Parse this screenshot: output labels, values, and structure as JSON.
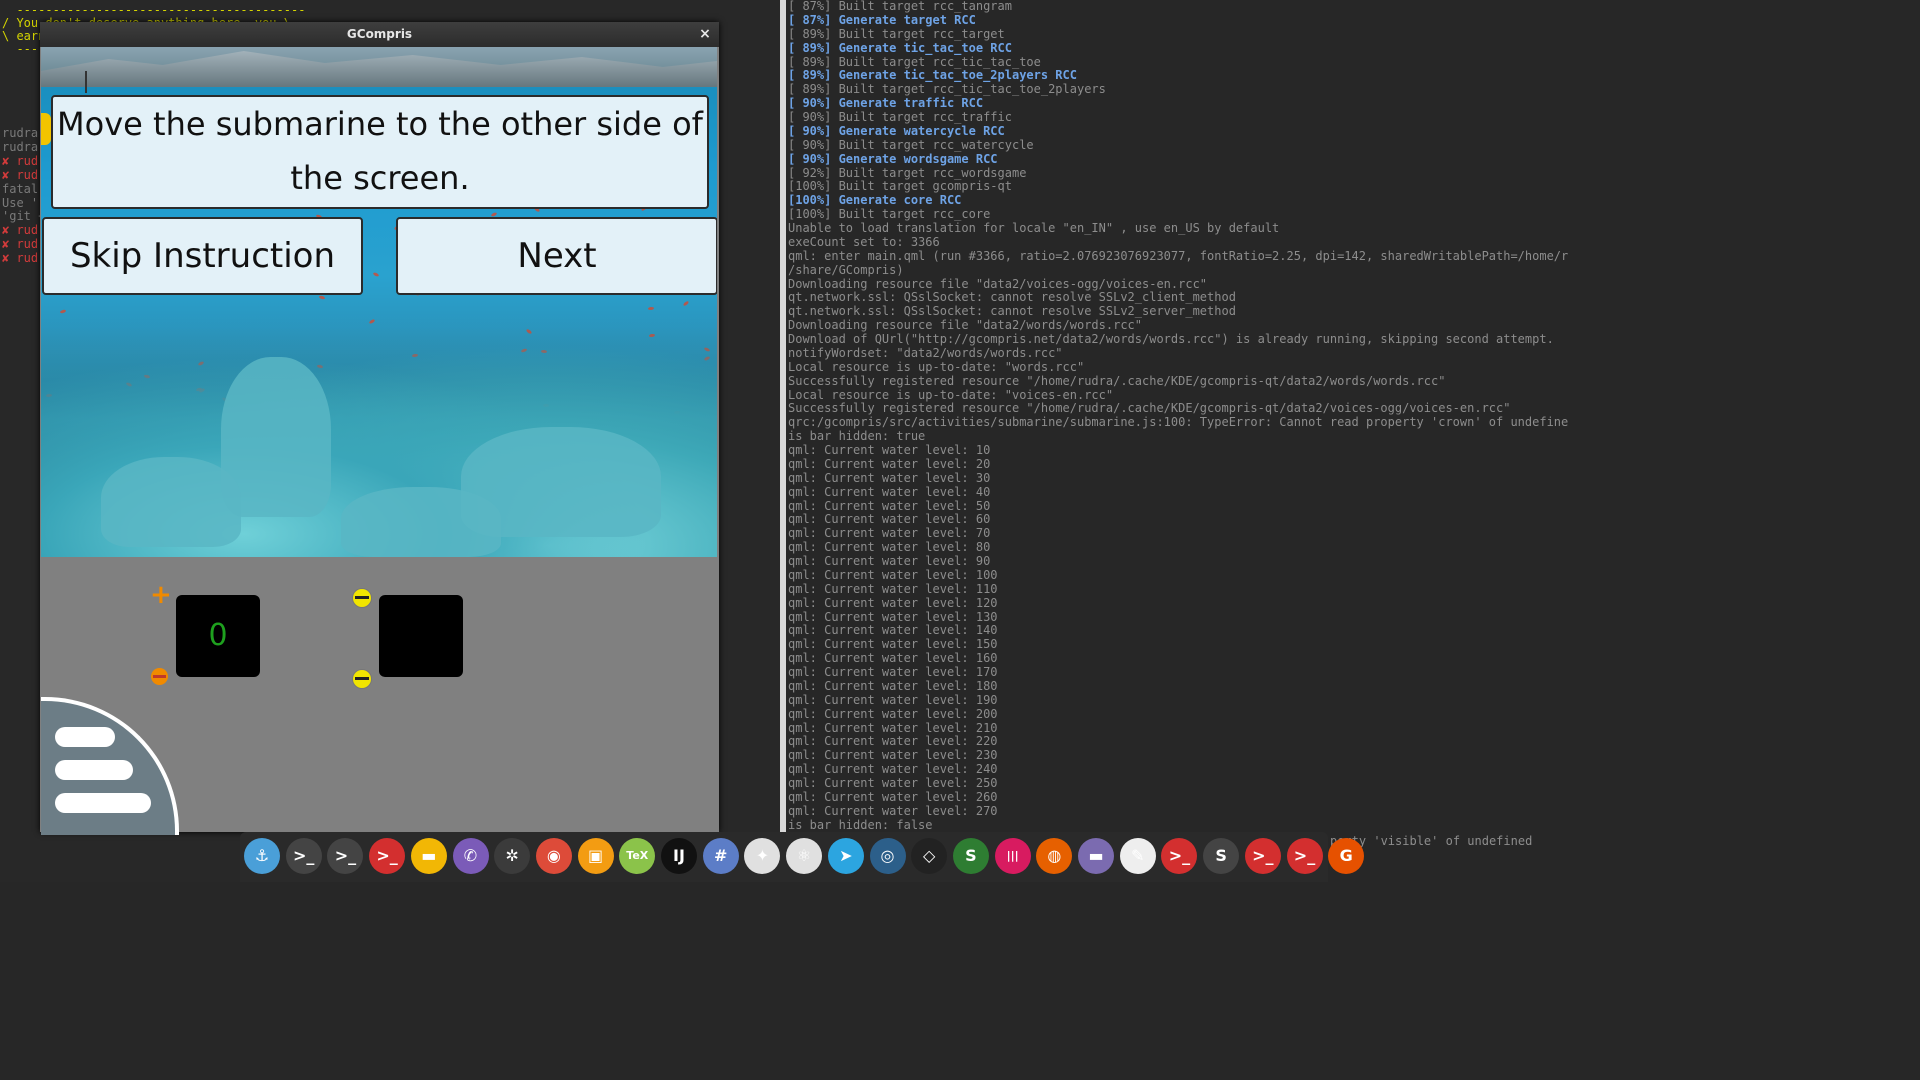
{
  "left_terminal": {
    "cowsay": [
      "  ----------------------------------------",
      "/ You don't deserve anything here, you \\",
      "\\ earn",
      "  ----"
    ],
    "snippets": [
      {
        "text": "rudra",
        "red": false
      },
      {
        "text": "rudra",
        "red": false
      },
      {
        "text": "✘ rud",
        "red": true
      },
      {
        "text": "✘ rud",
        "red": true
      },
      {
        "text": "fatal:",
        "red": false
      },
      {
        "text": "Use '-",
        "red": false
      },
      {
        "text": "'git <",
        "red": false
      },
      {
        "text": "✘ rud",
        "red": true
      },
      {
        "text": "✘ rud",
        "red": true
      },
      {
        "text": "✘ rud",
        "red": true
      }
    ]
  },
  "right_terminal": {
    "lines": [
      {
        "text": "[ 87%] Built target rcc_tangram",
        "gen": false
      },
      {
        "text": "[ 87%] Generate target RCC",
        "gen": true
      },
      {
        "text": "[ 89%] Built target rcc_target",
        "gen": false
      },
      {
        "text": "[ 89%] Generate tic_tac_toe RCC",
        "gen": true
      },
      {
        "text": "[ 89%] Built target rcc_tic_tac_toe",
        "gen": false
      },
      {
        "text": "[ 89%] Generate tic_tac_toe_2players RCC",
        "gen": true
      },
      {
        "text": "[ 89%] Built target rcc_tic_tac_toe_2players",
        "gen": false
      },
      {
        "text": "[ 90%] Generate traffic RCC",
        "gen": true
      },
      {
        "text": "[ 90%] Built target rcc_traffic",
        "gen": false
      },
      {
        "text": "[ 90%] Generate watercycle RCC",
        "gen": true
      },
      {
        "text": "[ 90%] Built target rcc_watercycle",
        "gen": false
      },
      {
        "text": "[ 90%] Generate wordsgame RCC",
        "gen": true
      },
      {
        "text": "[ 92%] Built target rcc_wordsgame",
        "gen": false
      },
      {
        "text": "[100%] Built target gcompris-qt",
        "gen": false
      },
      {
        "text": "[100%] Generate core RCC",
        "gen": true
      },
      {
        "text": "[100%] Built target rcc_core",
        "gen": false
      },
      {
        "text": "Unable to load translation for locale  \"en_IN\" , use en_US by default",
        "gen": false
      },
      {
        "text": "exeCount set to:  3366",
        "gen": false
      },
      {
        "text": "qml: enter main.qml (run #3366, ratio=2.076923076923077, fontRatio=2.25, dpi=142, sharedWritablePath=/home/rudra/.local",
        "gen": false
      },
      {
        "text": "/share/GCompris)",
        "gen": false
      },
      {
        "text": "Downloading resource file \"data2/voices-ogg/voices-en.rcc\"",
        "gen": false
      },
      {
        "text": "qt.network.ssl: QSslSocket: cannot resolve SSLv2_client_method",
        "gen": false
      },
      {
        "text": "qt.network.ssl: QSslSocket: cannot resolve SSLv2_server_method",
        "gen": false
      },
      {
        "text": "Downloading resource file \"data2/words/words.rcc\"",
        "gen": false
      },
      {
        "text": "Download of QUrl(\"http://gcompris.net/data2/words/words.rcc\") is already running, skipping second attempt.",
        "gen": false
      },
      {
        "text": "notifyWordset:  \"data2/words/words.rcc\"",
        "gen": false
      },
      {
        "text": "Local resource is up-to-date: \"words.rcc\"",
        "gen": false
      },
      {
        "text": "Successfully registered resource \"/home/rudra/.cache/KDE/gcompris-qt/data2/words/words.rcc\"",
        "gen": false
      },
      {
        "text": "Local resource is up-to-date: \"voices-en.rcc\"",
        "gen": false
      },
      {
        "text": "Successfully registered resource \"/home/rudra/.cache/KDE/gcompris-qt/data2/voices-ogg/voices-en.rcc\"",
        "gen": false
      },
      {
        "text": "qrc:/gcompris/src/activities/submarine/submarine.js:100: TypeError: Cannot read property 'crown' of undefined",
        "gen": false
      },
      {
        "text": "is bar hidden:  true",
        "gen": false
      },
      {
        "text": "qml: Current water level: 10",
        "gen": false
      },
      {
        "text": "qml: Current water level: 20",
        "gen": false
      },
      {
        "text": "qml: Current water level: 30",
        "gen": false
      },
      {
        "text": "qml: Current water level: 40",
        "gen": false
      },
      {
        "text": "qml: Current water level: 50",
        "gen": false
      },
      {
        "text": "qml: Current water level: 60",
        "gen": false
      },
      {
        "text": "qml: Current water level: 70",
        "gen": false
      },
      {
        "text": "qml: Current water level: 80",
        "gen": false
      },
      {
        "text": "qml: Current water level: 90",
        "gen": false
      },
      {
        "text": "qml: Current water level: 100",
        "gen": false
      },
      {
        "text": "qml: Current water level: 110",
        "gen": false
      },
      {
        "text": "qml: Current water level: 120",
        "gen": false
      },
      {
        "text": "qml: Current water level: 130",
        "gen": false
      },
      {
        "text": "qml: Current water level: 140",
        "gen": false
      },
      {
        "text": "qml: Current water level: 150",
        "gen": false
      },
      {
        "text": "qml: Current water level: 160",
        "gen": false
      },
      {
        "text": "qml: Current water level: 170",
        "gen": false
      },
      {
        "text": "qml: Current water level: 180",
        "gen": false
      },
      {
        "text": "qml: Current water level: 190",
        "gen": false
      },
      {
        "text": "qml: Current water level: 200",
        "gen": false
      },
      {
        "text": "qml: Current water level: 210",
        "gen": false
      },
      {
        "text": "qml: Current water level: 220",
        "gen": false
      },
      {
        "text": "qml: Current water level: 230",
        "gen": false
      },
      {
        "text": "qml: Current water level: 240",
        "gen": false
      },
      {
        "text": "qml: Current water level: 250",
        "gen": false
      },
      {
        "text": "qml: Current water level: 260",
        "gen": false
      },
      {
        "text": "qml: Current water level: 270",
        "gen": false
      },
      {
        "text": "is bar hidden:  false",
        "gen": false
      }
    ],
    "tail": "perty 'visible' of undefined"
  },
  "gcompris": {
    "window_title": "GCompris",
    "close_glyph": "×",
    "instruction": "Move the submarine to the other side of the screen.",
    "skip_label": "Skip Instruction",
    "next_label": "Next",
    "left_tank_value": "0",
    "right_tank_value": "",
    "plus_glyph": "+"
  },
  "dock": {
    "icons": [
      {
        "name": "anchor-icon",
        "glyph": "⚓",
        "color": "#4a9fd8"
      },
      {
        "name": "terminal-icon",
        "glyph": ">_",
        "color": "#444444"
      },
      {
        "name": "terminal-icon",
        "glyph": ">_",
        "color": "#444444"
      },
      {
        "name": "terminal-red-icon",
        "glyph": ">_",
        "color": "#d32f2f"
      },
      {
        "name": "files-icon",
        "glyph": "▬",
        "color": "#f2b705"
      },
      {
        "name": "viber-icon",
        "glyph": "✆",
        "color": "#7b5bb8"
      },
      {
        "name": "settings-flower-icon",
        "glyph": "✲",
        "color": "#3b3b3b"
      },
      {
        "name": "chrome-icon",
        "glyph": "◉",
        "color": "#dd4b39"
      },
      {
        "name": "screenshot-icon",
        "glyph": "▣",
        "color": "#f39c12"
      },
      {
        "name": "tex-icon",
        "glyph": "TeX",
        "color": "#8bc34a"
      },
      {
        "name": "intellij-icon",
        "glyph": "IJ",
        "color": "#111111"
      },
      {
        "name": "hashtag-icon",
        "glyph": "#",
        "color": "#5c7dc7"
      },
      {
        "name": "satellite-icon",
        "glyph": "✦",
        "color": "#e0e0e0"
      },
      {
        "name": "atom-icon",
        "glyph": "⚛",
        "color": "#e0e0e0"
      },
      {
        "name": "telegram-icon",
        "glyph": "➤",
        "color": "#2ca5e0"
      },
      {
        "name": "blender-icon",
        "glyph": "◎",
        "color": "#2c5f8a"
      },
      {
        "name": "unity-icon",
        "glyph": "◇",
        "color": "#222222"
      },
      {
        "name": "sublime-icon",
        "glyph": "S",
        "color": "#2e7d32"
      },
      {
        "name": "audio-icon",
        "glyph": "|||",
        "color": "#d81b60"
      },
      {
        "name": "firefox-icon",
        "glyph": "◍",
        "color": "#e66000"
      },
      {
        "name": "files-icon",
        "glyph": "▬",
        "color": "#7b6bb0"
      },
      {
        "name": "pen-icon",
        "glyph": "✎",
        "color": "#eeeeee"
      },
      {
        "name": "terminal-red-icon",
        "glyph": ">_",
        "color": "#d32f2f"
      },
      {
        "name": "sublime-text-icon",
        "glyph": "S",
        "color": "#444444"
      },
      {
        "name": "terminal-red-icon",
        "glyph": ">_",
        "color": "#d32f2f"
      },
      {
        "name": "terminal-red-icon",
        "glyph": ">_",
        "color": "#d32f2f"
      },
      {
        "name": "gcompris-icon",
        "glyph": "G",
        "color": "#e65100"
      }
    ]
  }
}
